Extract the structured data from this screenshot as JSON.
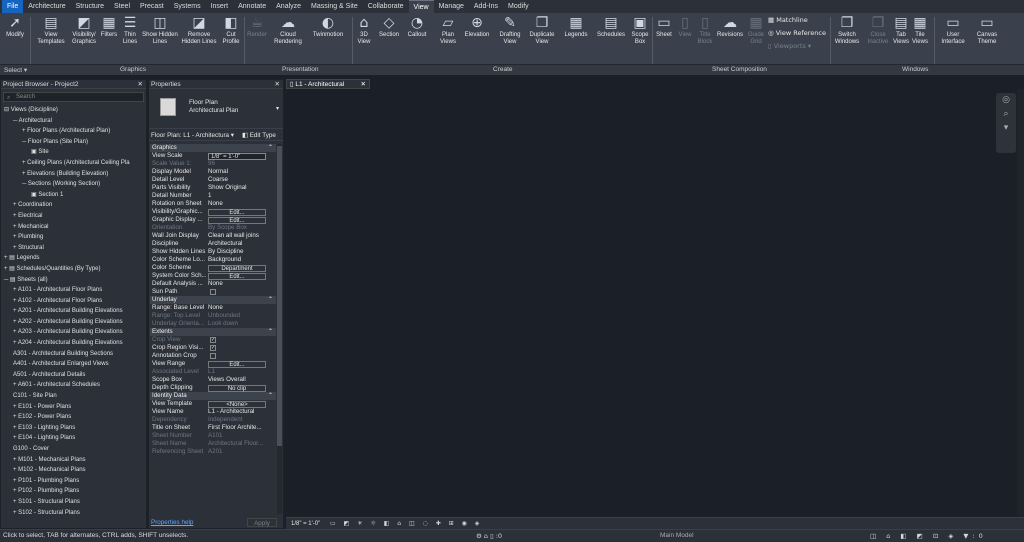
{
  "tabs": [
    "File",
    "Architecture",
    "Structure",
    "Steel",
    "Precast",
    "Systems",
    "Insert",
    "Annotate",
    "Analyze",
    "Massing & Site",
    "Collaborate",
    "View",
    "Manage",
    "Add-Ins",
    "Modify"
  ],
  "active_tab": "View",
  "ribbon": {
    "modify": "Modify",
    "select": "Select ▾",
    "view_templates": "View Templates",
    "visibility": "Visibility/ Graphics",
    "filters": "Filters",
    "thin_lines": "Thin Lines",
    "show_hidden": "Show Hidden Lines",
    "remove_hidden": "Remove Hidden Lines",
    "cut_profile": "Cut Profile",
    "render": "Render",
    "cloud_rendering": "Cloud Rendering",
    "twinmotion": "Twinmotion",
    "view3d": "3D View",
    "section": "Section",
    "callout": "Callout",
    "plan_views": "Plan Views",
    "elevation": "Elevation",
    "drafting_view": "Drafting View",
    "duplicate_view": "Duplicate View",
    "legends": "Legends",
    "schedules": "Schedules",
    "scope_box": "Scope Box",
    "sheet": "Sheet",
    "view": "View",
    "title_block": "Title Block",
    "revisions": "Revisions",
    "guide_grid": "Guide Grid",
    "matchline": "Matchline",
    "view_reference": "View Reference",
    "viewports": "Viewports",
    "switch_windows": "Switch Windows",
    "close_inactive": "Close Inactive",
    "tab_views": "Tab Views",
    "tile_views": "Tile Views",
    "user_interface": "User Interface",
    "canvas_theme": "Canvas Theme",
    "groups": {
      "select": "Select ▾",
      "graphics": "Graphics",
      "presentation": "Presentation",
      "create": "Create",
      "sheet_composition": "Sheet Composition",
      "windows": "Windows"
    }
  },
  "project_browser": {
    "title": "Project Browser - Project2",
    "search_placeholder": "Search",
    "tree": [
      {
        "t": "⊟ Views (Discipline)",
        "i": 0
      },
      {
        "t": "─ Architectural",
        "i": 1
      },
      {
        "t": "+ Floor Plans (Architectural Plan)",
        "i": 2
      },
      {
        "t": "─ Floor Plans (Site Plan)",
        "i": 2
      },
      {
        "t": "▣ Site",
        "i": 3
      },
      {
        "t": "+ Ceiling Plans (Architectural Ceiling Pla",
        "i": 2
      },
      {
        "t": "+ Elevations (Building Elevation)",
        "i": 2
      },
      {
        "t": "─ Sections (Working Section)",
        "i": 2
      },
      {
        "t": "▣ Section 1",
        "i": 3
      },
      {
        "t": "+ Coordination",
        "i": 1
      },
      {
        "t": "+ Electrical",
        "i": 1
      },
      {
        "t": "+ Mechanical",
        "i": 1
      },
      {
        "t": "+ Plumbing",
        "i": 1
      },
      {
        "t": "+ Structural",
        "i": 1
      },
      {
        "t": "+ ▤ Legends",
        "i": 0
      },
      {
        "t": "+ ▤ Schedules/Quantities (By Type)",
        "i": 0
      },
      {
        "t": "─ ▤ Sheets (all)",
        "i": 0
      },
      {
        "t": "+ A101 - Architectural Floor Plans",
        "i": 1
      },
      {
        "t": "+ A102 - Architectural Floor Plans",
        "i": 1
      },
      {
        "t": "+ A201 - Architectural Building Elevations",
        "i": 1
      },
      {
        "t": "+ A202 - Architectural Building Elevations",
        "i": 1
      },
      {
        "t": "+ A203 - Architectural Building Elevations",
        "i": 1
      },
      {
        "t": "+ A204 - Architectural Building Elevations",
        "i": 1
      },
      {
        "t": "A301 - Architectural Building Sections",
        "i": 1
      },
      {
        "t": "A401 - Architectural Enlarged Views",
        "i": 1
      },
      {
        "t": "A501 - Architectural Details",
        "i": 1
      },
      {
        "t": "+ A601 - Architectural Schedules",
        "i": 1
      },
      {
        "t": "C101 - Site Plan",
        "i": 1
      },
      {
        "t": "+ E101 - Power Plans",
        "i": 1
      },
      {
        "t": "+ E102 - Power Plans",
        "i": 1
      },
      {
        "t": "+ E103 - Lighting Plans",
        "i": 1
      },
      {
        "t": "+ E104 - Lighting Plans",
        "i": 1
      },
      {
        "t": "G100 - Cover",
        "i": 1
      },
      {
        "t": "+ M101 - Mechanical Plans",
        "i": 1
      },
      {
        "t": "+ M102 - Mechanical Plans",
        "i": 1
      },
      {
        "t": "+ P101 - Plumbing Plans",
        "i": 1
      },
      {
        "t": "+ P102 - Plumbing Plans",
        "i": 1
      },
      {
        "t": "+ S101 - Structural Plans",
        "i": 1
      },
      {
        "t": "+ S102 - Structural Plans",
        "i": 1
      }
    ]
  },
  "properties": {
    "title": "Properties",
    "type_name": "Floor Plan",
    "type_sub": "Architectural Plan",
    "instance": "Floor Plan: L1 - Architectura ▾",
    "edit_type": "Edit Type",
    "sections": [
      {
        "name": "Graphics",
        "rows": [
          {
            "k": "View Scale",
            "v": "1/8\" = 1'-0\"",
            "box": true
          },
          {
            "k": "Scale Value   1:",
            "v": "96",
            "dis": true
          },
          {
            "k": "Display Model",
            "v": "Normal"
          },
          {
            "k": "Detail Level",
            "v": "Coarse"
          },
          {
            "k": "Parts Visibility",
            "v": "Show Original"
          },
          {
            "k": "Detail Number",
            "v": "1"
          },
          {
            "k": "Rotation on Sheet",
            "v": "None"
          },
          {
            "k": "Visibility/Graphic...",
            "v": "Edit...",
            "btn": true
          },
          {
            "k": "Graphic Display ...",
            "v": "Edit...",
            "btn": true
          },
          {
            "k": "Orientation",
            "v": "By Scope Box",
            "dis": true
          },
          {
            "k": "Wall Join Display",
            "v": "Clean all wall joins"
          },
          {
            "k": "Discipline",
            "v": "Architectural"
          },
          {
            "k": "Show Hidden Lines",
            "v": "By Discipline"
          },
          {
            "k": "Color Scheme Lo...",
            "v": "Background"
          },
          {
            "k": "Color Scheme",
            "v": "Department",
            "btn": true
          },
          {
            "k": "System Color Sch...",
            "v": "Edit...",
            "btn": true
          },
          {
            "k": "Default Analysis ...",
            "v": "None"
          },
          {
            "k": "Sun Path",
            "v": "",
            "cb": ""
          }
        ]
      },
      {
        "name": "Underlay",
        "rows": [
          {
            "k": "Range: Base Level",
            "v": "None"
          },
          {
            "k": "Range: Top Level",
            "v": "Unbounded",
            "dis": true
          },
          {
            "k": "Underlay Orienta...",
            "v": "Look down",
            "dis": true
          }
        ]
      },
      {
        "name": "Extents",
        "rows": [
          {
            "k": "Crop View",
            "v": "",
            "cb": "✓",
            "dis": true
          },
          {
            "k": "Crop Region Visi...",
            "v": "",
            "cb": "✓"
          },
          {
            "k": "Annotation Crop",
            "v": "",
            "cb": ""
          },
          {
            "k": "View Range",
            "v": "Edit...",
            "btn": true
          },
          {
            "k": "Associated Level",
            "v": "L1",
            "dis": true
          },
          {
            "k": "Scope Box",
            "v": "Views Overall"
          },
          {
            "k": "Depth Clipping",
            "v": "No clip",
            "btn": true
          }
        ]
      },
      {
        "name": "Identity Data",
        "rows": [
          {
            "k": "View Template",
            "v": "<None>",
            "btn": true
          },
          {
            "k": "View Name",
            "v": "L1 - Architectural"
          },
          {
            "k": "Dependency",
            "v": "Independent",
            "dis": true
          },
          {
            "k": "Title on Sheet",
            "v": "First Floor Archite..."
          },
          {
            "k": "Sheet Number",
            "v": "A101",
            "dis": true
          },
          {
            "k": "Sheet Name",
            "v": "Architectural Floor...",
            "dis": true
          },
          {
            "k": "Referencing Sheet",
            "v": "A201",
            "dis": true
          }
        ]
      }
    ],
    "help": "Properties help",
    "apply": "Apply"
  },
  "view_tab": "L1 - Architectural",
  "view_scale": "1/8\" = 1'-0\"",
  "status": {
    "message": "Click to select, TAB for alternates, CTRL adds, SHIFT unselects.",
    "zero": ":0",
    "model": "Main Model",
    "filter": ":0"
  }
}
